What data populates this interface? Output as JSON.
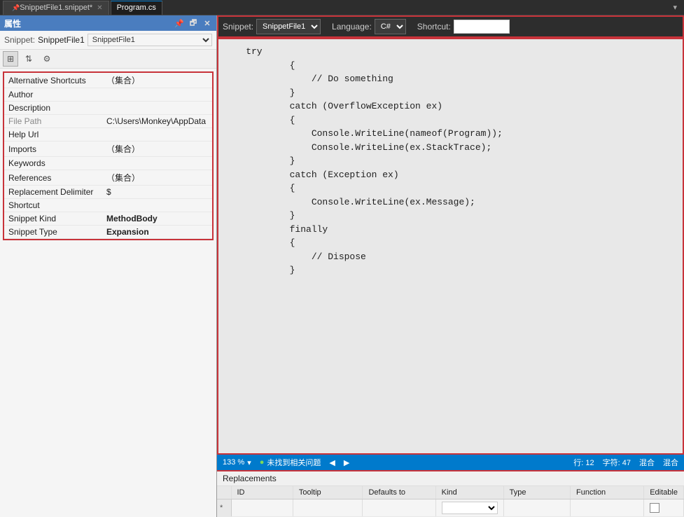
{
  "app": {
    "title": "属性"
  },
  "tabs": [
    {
      "id": "snippet",
      "label": "SnippetFile1.snippet*",
      "pinned": true,
      "closable": true,
      "active": false
    },
    {
      "id": "program",
      "label": "Program.cs",
      "pinned": false,
      "closable": false,
      "active": true
    }
  ],
  "left_panel": {
    "title": "属性",
    "icons": [
      "pin-icon",
      "close-icon"
    ],
    "snippet_label": "Snippet:",
    "snippet_value": "SnippetFile1",
    "toolbar_buttons": [
      {
        "id": "grid-view",
        "icon": "⊞",
        "active": true
      },
      {
        "id": "sort-view",
        "icon": "⇅",
        "active": false
      },
      {
        "id": "gear",
        "icon": "⚙",
        "active": false
      }
    ],
    "properties": [
      {
        "name": "Alternative Shortcuts",
        "value": "（集合）"
      },
      {
        "name": "Author",
        "value": ""
      },
      {
        "name": "Description",
        "value": ""
      },
      {
        "name": "File Path",
        "value": "C:\\Users\\Monkey\\AppData",
        "nameClass": "gray"
      },
      {
        "name": "Help Url",
        "value": ""
      },
      {
        "name": "Imports",
        "value": "（集合）"
      },
      {
        "name": "Keywords",
        "value": ""
      },
      {
        "name": "References",
        "value": "（集合）"
      },
      {
        "name": "Replacement Delimiter",
        "value": "$"
      },
      {
        "name": "Shortcut",
        "value": ""
      },
      {
        "name": "Snippet Kind",
        "value": "MethodBody",
        "valueBold": true
      },
      {
        "name": "Snippet Type",
        "value": "Expansion",
        "valueBold": true
      }
    ]
  },
  "snippet_toolbar": {
    "snippet_label": "Snippet:",
    "snippet_value": "SnippetFile1",
    "language_label": "Language:",
    "language_value": "C#",
    "shortcut_label": "Shortcut:",
    "shortcut_value": ""
  },
  "code": {
    "content": "    try\n            {\n                // Do something\n            }\n            catch (OverflowException ex)\n            {\n                Console.WriteLine(nameof(Program));\n                Console.WriteLine(ex.StackTrace);\n            }\n            catch (Exception ex)\n            {\n                Console.WriteLine(ex.Message);\n            }\n            finally\n            {\n                // Dispose\n            }"
  },
  "status_bar": {
    "zoom": "133 %",
    "zoom_dropdown": "▾",
    "status_icon": "●",
    "status_text": "未找到相关问题",
    "line": "行: 12",
    "char": "字符: 47",
    "encoding1": "混合",
    "encoding2": "混合"
  },
  "bottom_panel": {
    "title": "Replacements",
    "columns": [
      "ID",
      "Tooltip",
      "Defaults to",
      "Kind",
      "Type",
      "Function",
      "Editable"
    ],
    "rows": [
      {
        "marker": "*",
        "id": "",
        "tooltip": "",
        "defaults_to": "",
        "kind": "",
        "type": "",
        "function": "",
        "editable": false
      }
    ]
  }
}
